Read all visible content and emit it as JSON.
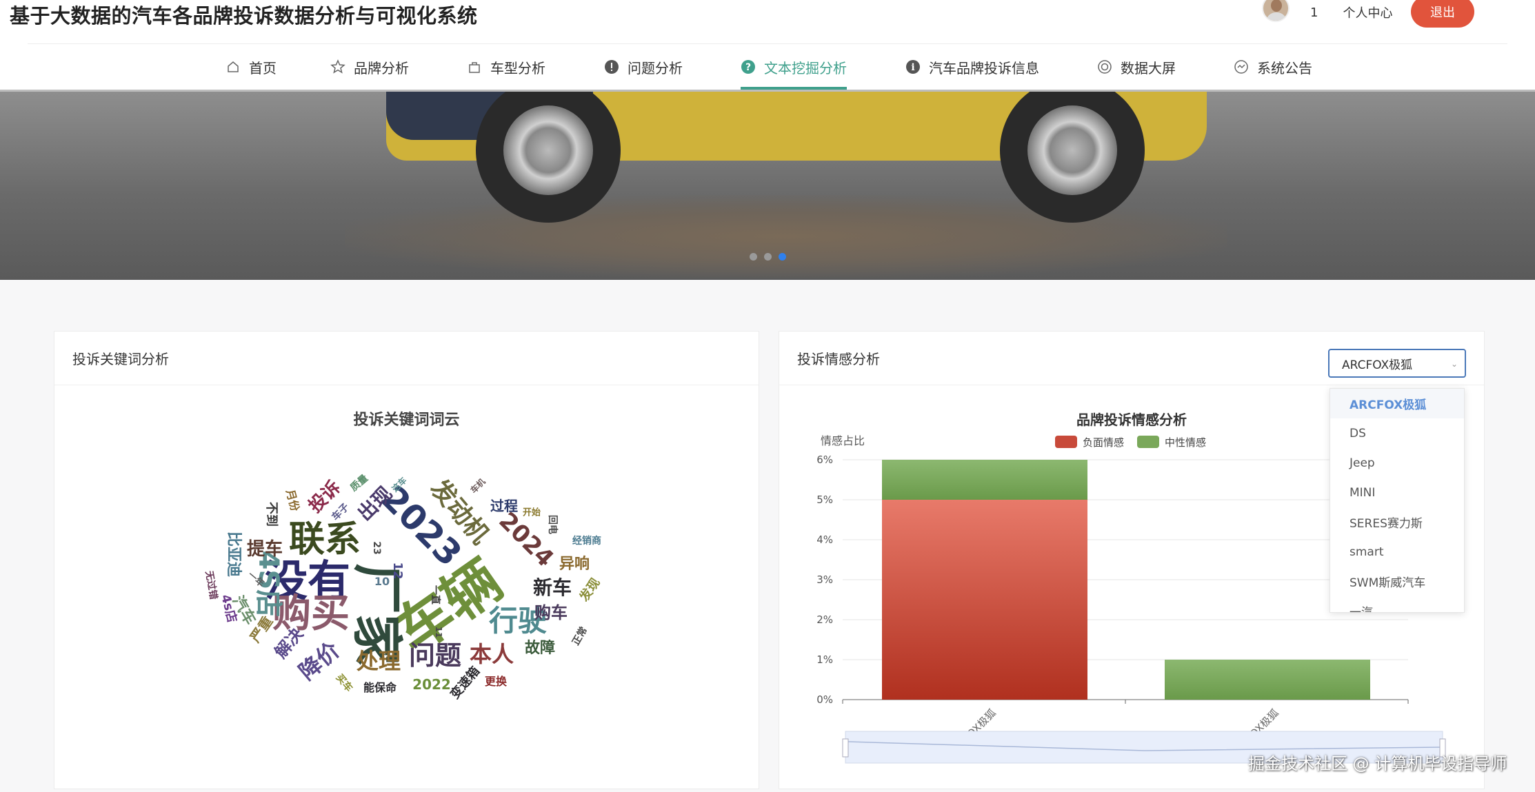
{
  "header": {
    "title": "基于大数据的汽车各品牌投诉数据分析与可视化系统",
    "user_count": "1",
    "user_center": "个人中心",
    "logout": "退出"
  },
  "nav": [
    {
      "label": "首页",
      "icon": "home-icon"
    },
    {
      "label": "品牌分析",
      "icon": "star-icon"
    },
    {
      "label": "车型分析",
      "icon": "bag-icon"
    },
    {
      "label": "问题分析",
      "icon": "alert-circle-icon"
    },
    {
      "label": "文本挖掘分析",
      "icon": "question-circle-icon",
      "active": true
    },
    {
      "label": "汽车品牌投诉信息",
      "icon": "info-circle-icon"
    },
    {
      "label": "数据大屏",
      "icon": "lifebuoy-icon"
    },
    {
      "label": "系统公告",
      "icon": "notice-icon"
    }
  ],
  "banner": {
    "slides": 3,
    "active_slide": 3
  },
  "keyword_panel": {
    "title": "投诉关键词分析",
    "chart_title": "投诉关键词词云",
    "words": [
      {
        "t": "车辆",
        "c": "#6e8f3a",
        "r": -35
      },
      {
        "t": "厂家",
        "c": "#2f4a3c",
        "r": 90
      },
      {
        "t": "没有",
        "c": "#2b2a6b",
        "r": 0
      },
      {
        "t": "购买",
        "c": "#8b5a6b",
        "r": 0
      },
      {
        "t": "联系",
        "c": "#3b4a1f",
        "r": 0
      },
      {
        "t": "2023",
        "c": "#2c3a6b",
        "r": 45
      },
      {
        "t": "行驶",
        "c": "#4f8a8f",
        "r": 0
      },
      {
        "t": "问题",
        "c": "#4a3a5c",
        "r": 0
      },
      {
        "t": "发动机",
        "c": "#6b6a3c",
        "r": 50
      },
      {
        "t": "2024",
        "c": "#6b3a3a",
        "r": 45
      },
      {
        "t": "4S店",
        "c": "#5a8f8f",
        "r": 90
      },
      {
        "t": "本人",
        "c": "#8b3a3a",
        "r": 0
      },
      {
        "t": "处理",
        "c": "#8b6a2f",
        "r": 0
      },
      {
        "t": "降价",
        "c": "#5a4a8b",
        "r": -40
      },
      {
        "t": "新车",
        "c": "#2b2a2f",
        "r": 0
      },
      {
        "t": "出现",
        "c": "#4a3a6b",
        "r": -45
      },
      {
        "t": "投诉",
        "c": "#8b2a4a",
        "r": -45
      },
      {
        "t": "提车",
        "c": "#5a3a2f",
        "r": 0
      },
      {
        "t": "购车",
        "c": "#4a3a5c",
        "r": 0
      },
      {
        "t": "故障",
        "c": "#3a5a3a",
        "r": 0
      },
      {
        "t": "异响",
        "c": "#8b6a2f",
        "r": 0
      },
      {
        "t": "解决",
        "c": "#5a4a8b",
        "r": -50
      },
      {
        "t": "比亚迪",
        "c": "#4a7a8f",
        "r": 90
      },
      {
        "t": "汽车",
        "c": "#6b8f6b",
        "r": 60
      },
      {
        "t": "严重",
        "c": "#8b7a3a",
        "r": -55
      },
      {
        "t": "过程",
        "c": "#2c3a6b",
        "r": 0
      },
      {
        "t": "4s店",
        "c": "#6b3a8b",
        "r": 75
      },
      {
        "t": "不到",
        "c": "#3a3a3a",
        "r": 90
      },
      {
        "t": "2022",
        "c": "#6b8f3a",
        "r": 0
      },
      {
        "t": "变速箱",
        "c": "#2b2a2f",
        "r": -50
      },
      {
        "t": "发现",
        "c": "#8b8f3a",
        "r": -55
      },
      {
        "t": "车子",
        "c": "#5a5a8b",
        "r": -45
      },
      {
        "t": "质量",
        "c": "#5a8f6b",
        "r": -40
      },
      {
        "t": "月份",
        "c": "#8b6a2f",
        "r": 75
      },
      {
        "t": "10",
        "c": "#5a7a8f",
        "r": 0
      },
      {
        "t": "12",
        "c": "#4a4a8b",
        "r": 90
      },
      {
        "t": "23",
        "c": "#4a4a4a",
        "r": 90
      },
      {
        "t": "能保命",
        "c": "#2b2a2f",
        "r": 0
      },
      {
        "t": "更换",
        "c": "#8b2a2a",
        "r": 0
      },
      {
        "t": "经销商",
        "c": "#4a7a8f",
        "r": 0
      },
      {
        "t": "开始",
        "c": "#8b7a2f",
        "r": 0
      },
      {
        "t": "车机",
        "c": "#6b5a5a",
        "r": -45
      },
      {
        "t": "这车",
        "c": "#5a8f8f",
        "r": -45
      },
      {
        "t": "正常",
        "c": "#4a4a4a",
        "r": -60
      },
      {
        "t": "买车",
        "c": "#8b8f2f",
        "r": 50
      },
      {
        "t": "一直",
        "c": "#3a3a3a",
        "r": 90
      },
      {
        "t": "一年",
        "c": "#5a5a5a",
        "r": 40
      },
      {
        "t": "无过错",
        "c": "#6b3a5a",
        "r": 80
      },
      {
        "t": "回电",
        "c": "#4a4a4a",
        "r": 90
      },
      {
        "t": "11",
        "c": "#4a4a4a",
        "r": 90
      }
    ]
  },
  "sentiment_panel": {
    "title": "投诉情感分析",
    "select_value": "ARCFOX极狐",
    "dropdown_options": [
      "ARCFOX极狐",
      "DS",
      "Jeep",
      "MINI",
      "SERES赛力斯",
      "smart",
      "SWM斯威汽车",
      "一汽"
    ]
  },
  "chart_data": {
    "type": "bar",
    "title": "品牌投诉情感分析",
    "ylabel": "情感占比",
    "categories": [
      "ARCFOX极狐",
      "ARCFOX极狐"
    ],
    "ylim": [
      0,
      6
    ],
    "y_ticks": [
      "0%",
      "1%",
      "2%",
      "3%",
      "4%",
      "5%",
      "6%"
    ],
    "stacked": true,
    "series": [
      {
        "name": "负面情感",
        "color": "#c84a3a",
        "values": [
          5,
          0
        ]
      },
      {
        "name": "中性情感",
        "color": "#7aa85a",
        "values": [
          1,
          1
        ]
      }
    ],
    "legend": "top-center"
  },
  "watermark": "掘金技术社区 @ 计算机毕设指导师"
}
